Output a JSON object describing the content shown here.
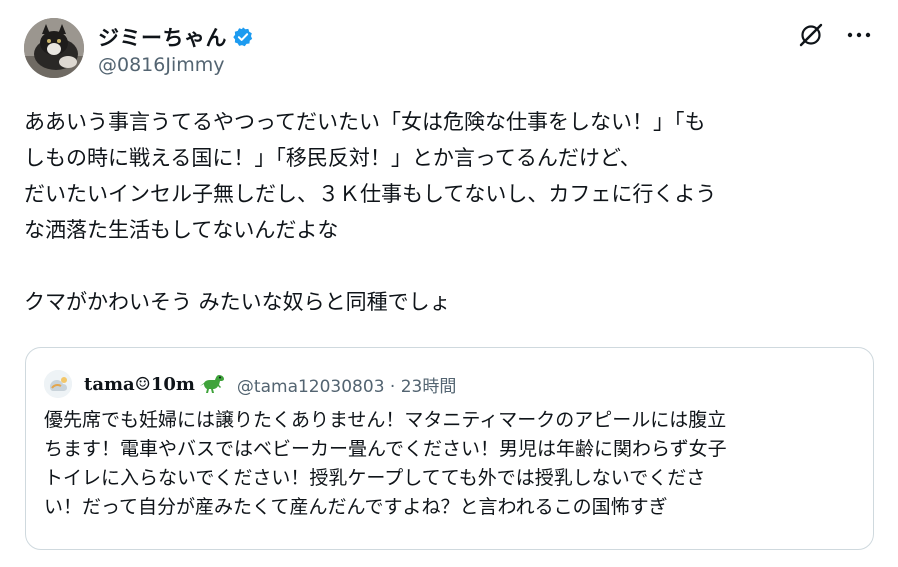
{
  "post": {
    "author": {
      "display_name": "ジミーちゃん",
      "handle": "@0816Jimmy",
      "verified": true
    },
    "body_lines": [
      "ああいう事言うてるやつってだいたい「女は危険な仕事をしない！」「も",
      "しもの時に戦える国に！」「移民反対！」とか言ってるんだけど、",
      "だいたいインセル子無しだし、３Ｋ仕事もしてないし、カフェに行くよう",
      "な洒落た生活もしてないんだよな"
    ],
    "body_para2": "クマがかわいそう みたいな奴らと同種でしょ",
    "actions": [
      "grok-icon",
      "more-icon"
    ]
  },
  "quote": {
    "author_name": "tama☺10m",
    "handle_time": "@tama12030803 · 23時間",
    "body_lines": [
      "優先席でも妊婦には譲りたくありません！マタニティマークのアピールには腹立",
      "ちます！電車やバスではベビーカー畳んでください！男児は年齢に関わらず女子",
      "トイレに入らないでください！授乳ケープしてても外では授乳しないでくださ",
      "い！だって自分が産みたくて産んだんですよね？と言われるこの国怖すぎ"
    ]
  },
  "colors": {
    "text": "#0f1419",
    "secondary": "#536471",
    "verified": "#1d9bf0",
    "border": "#cfd9de",
    "dino": "#3fa33b"
  }
}
